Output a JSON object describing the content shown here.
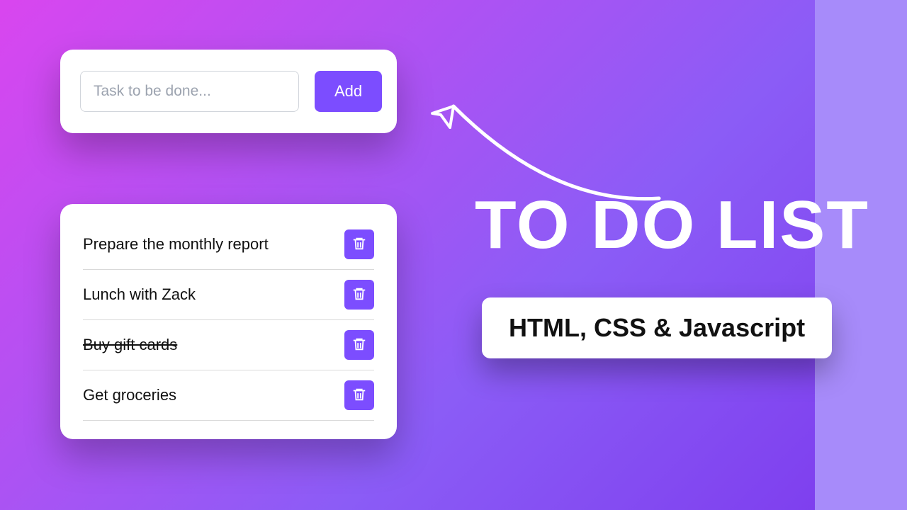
{
  "input": {
    "placeholder": "Task to be done...",
    "add_label": "Add"
  },
  "tasks": [
    {
      "text": "Prepare the monthly report",
      "done": false
    },
    {
      "text": "Lunch with Zack",
      "done": false
    },
    {
      "text": "Buy gift cards",
      "done": true
    },
    {
      "text": "Get groceries",
      "done": false
    }
  ],
  "heading": "TO DO LIST",
  "subtitle": "HTML, CSS & Javascript",
  "colors": {
    "accent": "#7c4dff",
    "gradient_start": "#d946ef",
    "gradient_end": "#7c3aed"
  }
}
